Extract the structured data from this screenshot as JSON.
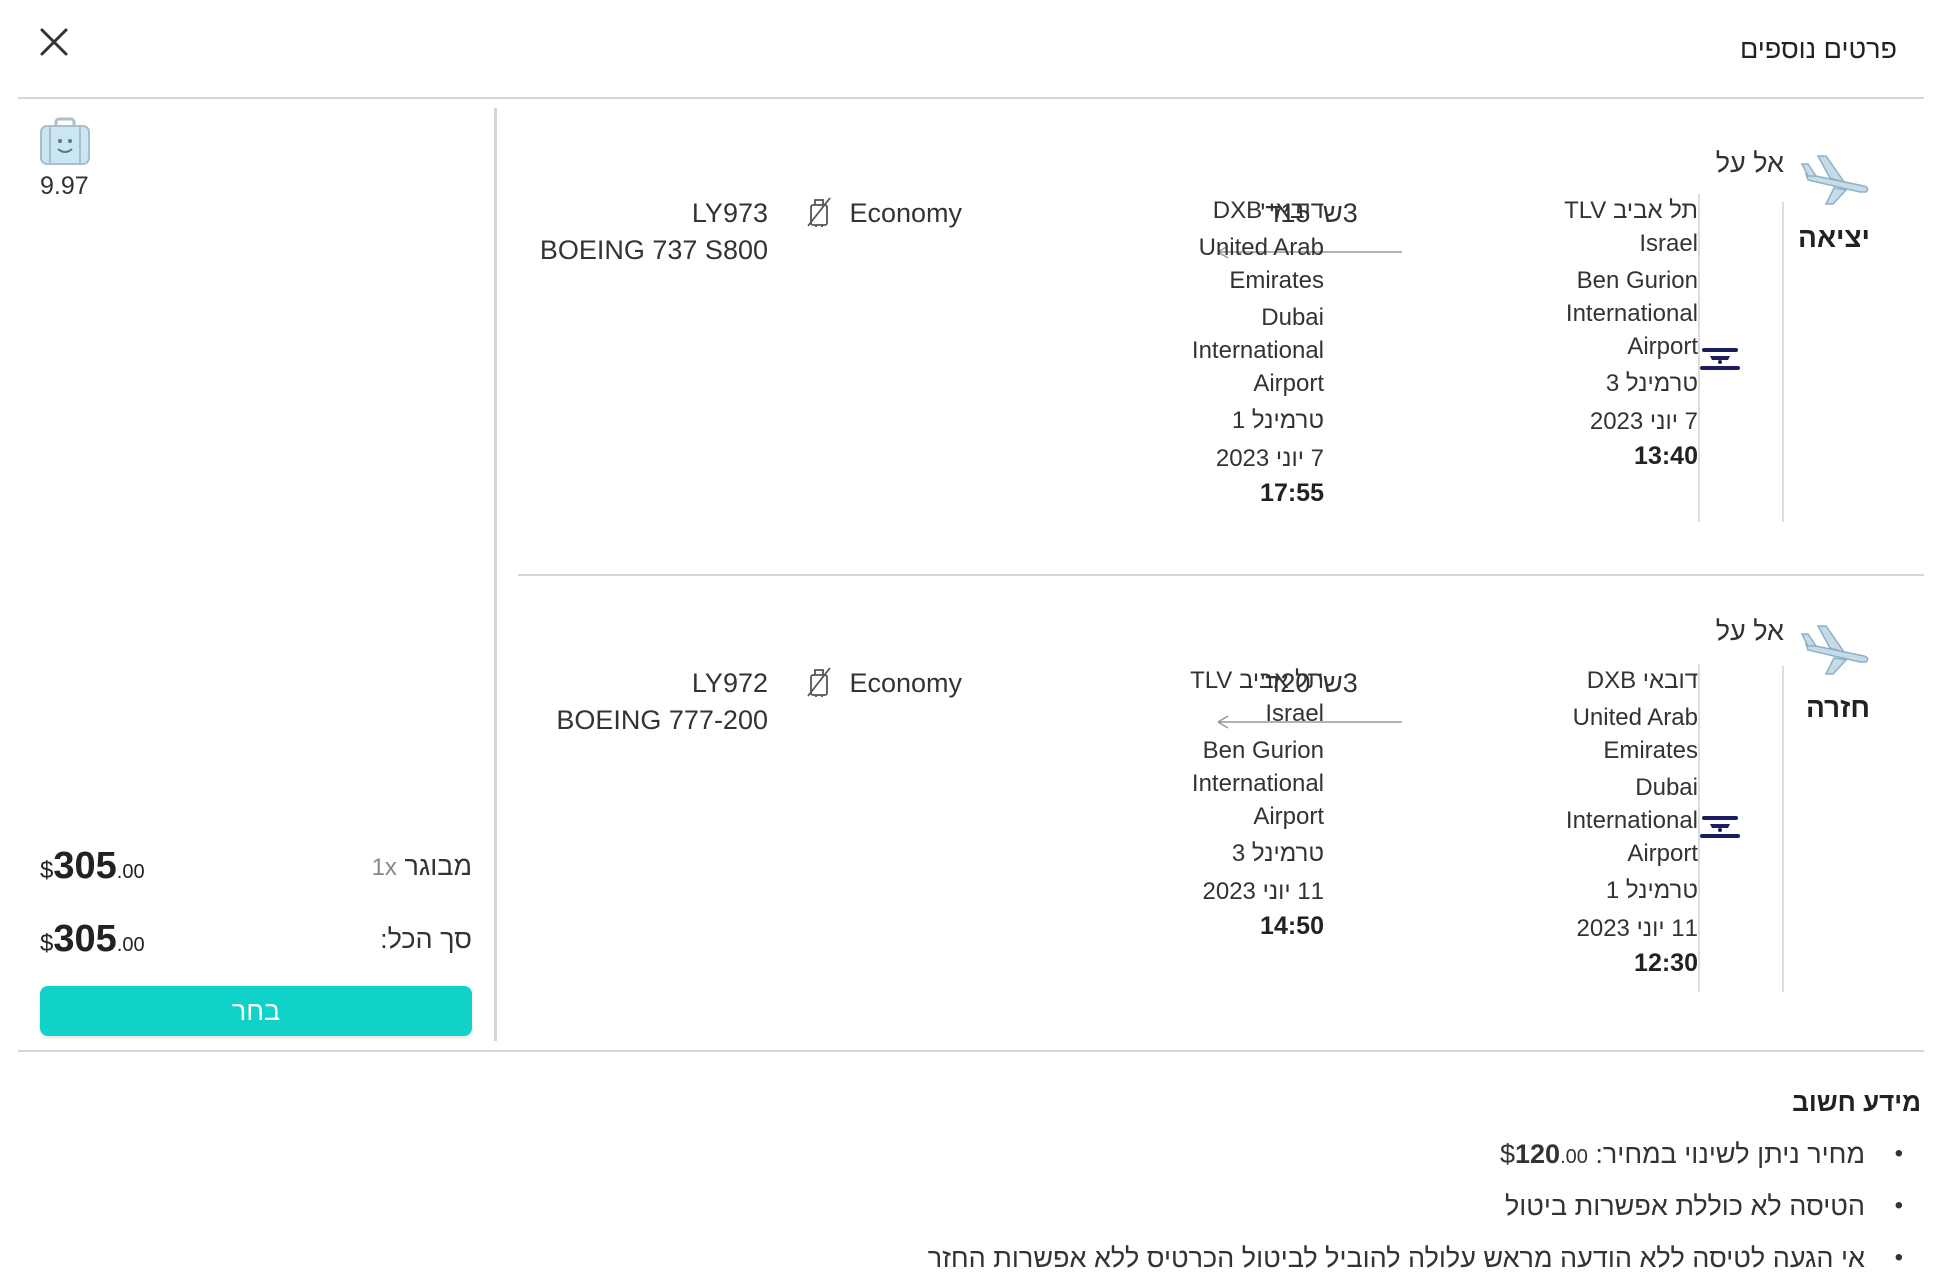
{
  "header": {
    "title": "פרטים נוספים",
    "close_icon": "close-icon"
  },
  "left_panel": {
    "baggage_weight": "9.97",
    "adult_label": "מבוגר",
    "adult_qty": "1x",
    "adult_price_currency": "$",
    "adult_price_main": "305",
    "adult_price_cents": ".00",
    "total_label": "סך הכל:",
    "total_price_currency": "$",
    "total_price_main": "305",
    "total_price_cents": ".00",
    "select_button": "בחר",
    "select_button_color": "#10d2c8"
  },
  "segments": [
    {
      "direction": "יציאה",
      "airline": "אל על",
      "origin": {
        "city": "תל אביב TLV",
        "country": "Israel",
        "airport_lines": [
          "Ben Gurion",
          "International",
          "Airport"
        ],
        "terminal": "טרמינל 3",
        "date": "7 יוני 2023",
        "time": "13:40"
      },
      "duration": "3ש' 15ד'",
      "destination": {
        "city": "דובאי DXB",
        "country_lines": [
          "United Arab",
          "Emirates"
        ],
        "airport_lines": [
          "Dubai",
          "International",
          "Airport"
        ],
        "terminal": "טרמינל 1",
        "date": "7 יוני 2023",
        "time": "17:55"
      },
      "cabin": "Economy",
      "flight_number": "LY973",
      "aircraft": "BOEING 737 S800"
    },
    {
      "direction": "חזרה",
      "airline": "אל על",
      "origin": {
        "city": "דובאי DXB",
        "country_lines": [
          "United Arab",
          "Emirates"
        ],
        "airport_lines": [
          "Dubai",
          "International",
          "Airport"
        ],
        "terminal": "טרמינל 1",
        "date": "11 יוני 2023",
        "time": "12:30"
      },
      "duration": "3ש' 20ד'",
      "destination": {
        "city": "תל אביב TLV",
        "country": "Israel",
        "airport_lines": [
          "Ben Gurion",
          "International",
          "Airport"
        ],
        "terminal": "טרמינל 3",
        "date": "11 יוני 2023",
        "time": "14:50"
      },
      "cabin": "Economy",
      "flight_number": "LY972",
      "aircraft": "BOEING 777-200"
    }
  ],
  "important_info": {
    "title": "מידע חשוב",
    "item1_text": "מחיר ניתן לשינוי במחיר: ",
    "item1_price_currency": "$",
    "item1_price_main": "120",
    "item1_price_cents": ".00",
    "item2_text": "הטיסה לא כוללת אפשרות ביטול",
    "item3_text": "אי הגעה לטיסה ללא הודעה מראש עלולה להוביל לביטול הכרטיס ללא אפשרות החזר"
  }
}
